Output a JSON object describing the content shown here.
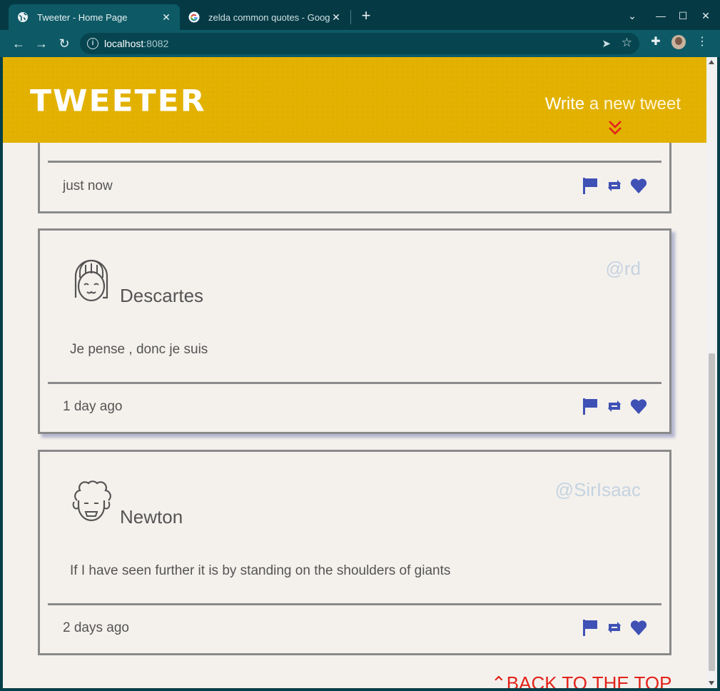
{
  "browser": {
    "tabs": [
      {
        "title": "Tweeter - Home Page",
        "active": true
      },
      {
        "title": "zelda common quotes - Google",
        "active": false
      }
    ],
    "url_host": "localhost",
    "url_port": ":8082"
  },
  "header": {
    "brand": "TWEETER",
    "compose_bold": "Write",
    "compose_rest": " a new tweet"
  },
  "tweets": [
    {
      "time": "just now"
    },
    {
      "name": "Descartes",
      "handle": "@rd",
      "text": "Je pense , donc je suis",
      "time": "1 day ago"
    },
    {
      "name": "Newton",
      "handle": "@SirIsaac",
      "text": "If I have seen further it is by standing on the shoulders of giants",
      "time": "2 days ago"
    }
  ],
  "footer": {
    "back_to_top": "BACK TO THE TOP"
  },
  "colors": {
    "header_bg": "#e2b100",
    "accent_red": "#e2231a",
    "action_icons": "#3f51b5",
    "handle": "#c5d3e0"
  }
}
